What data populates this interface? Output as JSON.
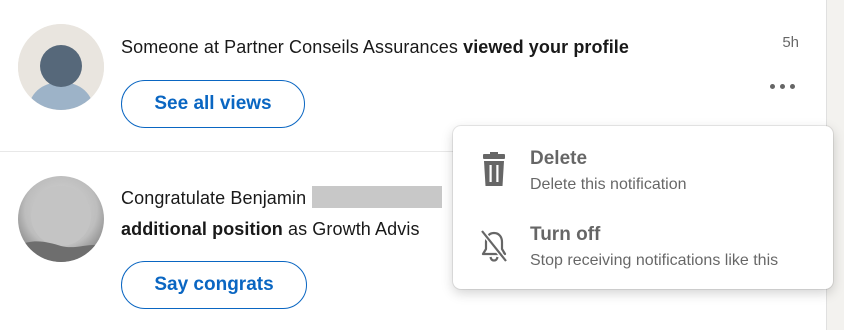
{
  "notifications": [
    {
      "prefix": "Someone at Partner Conseils Assurances ",
      "bold": "viewed your profile",
      "time": "5h",
      "action_label": "See all views"
    },
    {
      "prefix": "Congratulate Benjamin",
      "bold": "additional position",
      "suffix": " as Growth Advis",
      "action_label": "Say congrats"
    }
  ],
  "menu": {
    "items": [
      {
        "title": "Delete",
        "subtitle": "Delete this notification",
        "icon": "trash-icon"
      },
      {
        "title": "Turn off",
        "subtitle": "Stop receiving notifications like this",
        "icon": "bell-off-icon"
      }
    ]
  },
  "colors": {
    "accent": "#0a66c2",
    "muted_text": "#666666",
    "background": "#f3f2ef"
  }
}
